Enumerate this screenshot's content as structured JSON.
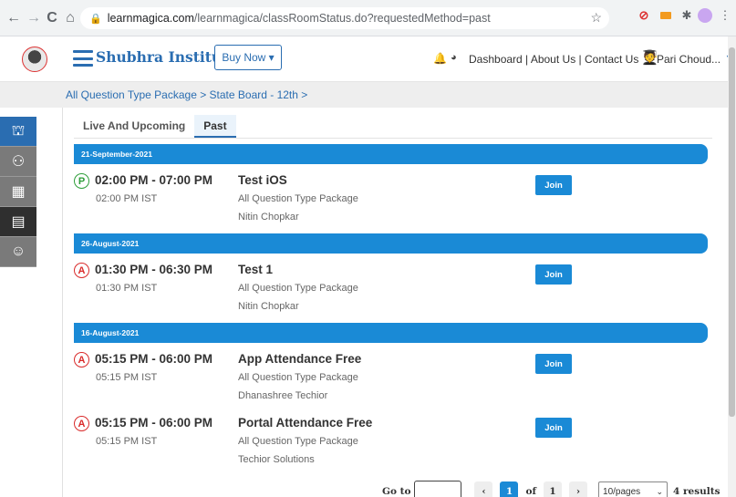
{
  "browser": {
    "url_host": "learnmagica.com",
    "url_path": "/learnmagica/classRoomStatus.do?requestedMethod=past",
    "back": "←",
    "forward": "→",
    "reload": "C",
    "home": "⌂",
    "lock": "🔒",
    "star": "☆"
  },
  "header": {
    "brand": "Shubhra Institute",
    "buy_now": "Buy Now ▾",
    "links": "Dashboard | About Us | Contact Us",
    "user": "Pari Choud...",
    "caret": "▼"
  },
  "breadcrumb": "All Question Type Package > State Board - 12th >",
  "tabs": [
    {
      "label": "Live And Upcoming"
    },
    {
      "label": "Past"
    }
  ],
  "days": [
    {
      "date": "21-September-2021"
    },
    {
      "date": "26-August-2021"
    },
    {
      "date": "16-August-2021"
    }
  ],
  "sessions": [
    {
      "status": "P",
      "time": "02:00 PM - 07:00 PM",
      "tz": "02:00 PM IST",
      "title": "Test iOS",
      "package": "All Question Type Package",
      "teacher": "Nitin Chopkar",
      "join": "Join"
    },
    {
      "status": "A",
      "time": "01:30 PM - 06:30 PM",
      "tz": "01:30 PM IST",
      "title": "Test 1",
      "package": "All Question Type Package",
      "teacher": "Nitin Chopkar",
      "join": "Join"
    },
    {
      "status": "A",
      "time": "05:15 PM - 06:00 PM",
      "tz": "05:15 PM IST",
      "title": "App Attendance Free",
      "package": "All Question Type Package",
      "teacher": "Dhanashree Techior",
      "join": "Join"
    },
    {
      "status": "A",
      "time": "05:15 PM - 06:00 PM",
      "tz": "05:15 PM IST",
      "title": "Portal Attendance Free",
      "package": "All Question Type Package",
      "teacher": "Techior Solutions",
      "join": "Join"
    }
  ],
  "pagination": {
    "goto_label": "Go to",
    "prev": "‹",
    "current_page": "1",
    "of_label": "of",
    "total_pages": "1",
    "next": "›",
    "page_size": "10/pages",
    "results": "4 results"
  },
  "colors": {
    "accent": "#1a8ad6",
    "brand": "#2a6db1",
    "present": "#2e9e3a",
    "absent": "#d92b2b"
  }
}
